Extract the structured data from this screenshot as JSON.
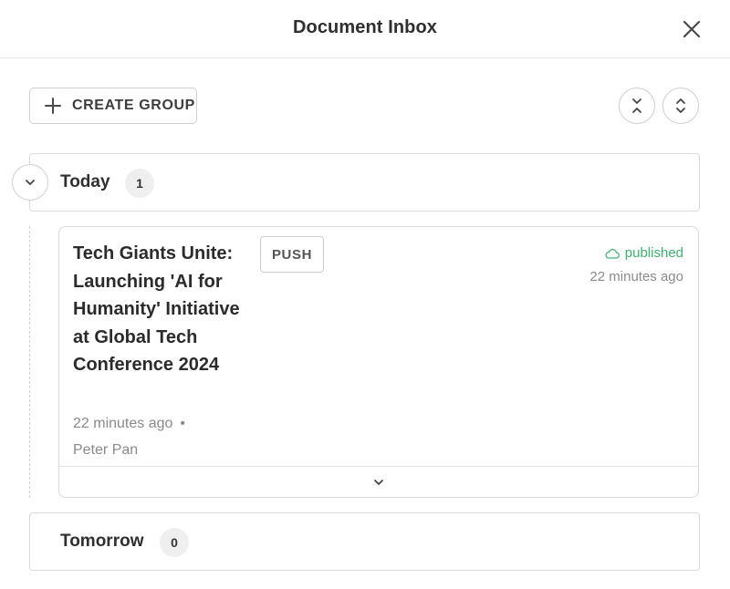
{
  "header": {
    "title": "Document Inbox",
    "close_icon": "close-icon"
  },
  "toolbar": {
    "create_group_label": "CREATE GROUP",
    "create_group_icon": "plus-icon",
    "collapse_all_icon": "collapse-all-icon",
    "expand_all_icon": "expand-all-icon"
  },
  "groups": [
    {
      "title": "Today",
      "count": "1",
      "expanded": true,
      "toggle_icon": "chevron-down-icon",
      "documents": [
        {
          "title": "Tech Giants Unite: Launching 'AI for Humanity' Initiative at Global Tech Conference 2024",
          "time": "22 minutes ago",
          "separator": "•",
          "author": "Peter Pan",
          "badge": "PUSH",
          "status": "published",
          "status_icon": "cloud-icon",
          "status_time": "22 minutes ago",
          "expand_icon": "chevron-down-icon"
        }
      ]
    },
    {
      "title": "Tomorrow",
      "count": "0",
      "expanded": false
    }
  ],
  "colors": {
    "published": "#3cb371",
    "border": "#d9d9d9",
    "muted_text": "#8a8a8a",
    "badge_bg": "#efefef"
  }
}
